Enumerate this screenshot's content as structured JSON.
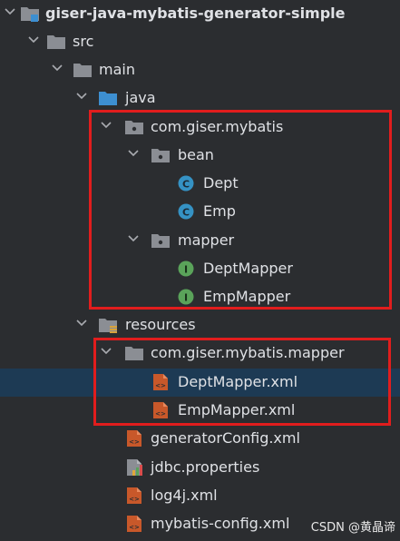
{
  "tree": {
    "root": "giser-java-mybatis-generator-simple",
    "src": "src",
    "main": "main",
    "java": "java",
    "pkg": "com.giser.mybatis",
    "bean": "bean",
    "dept": "Dept",
    "emp": "Emp",
    "mapper": "mapper",
    "dept_mapper": "DeptMapper",
    "emp_mapper": "EmpMapper",
    "resources": "resources",
    "res_pkg": "com.giser.mybatis.mapper",
    "dept_mapper_xml": "DeptMapper.xml",
    "emp_mapper_xml": "EmpMapper.xml",
    "generator_config": "generatorConfig.xml",
    "jdbc_props": "jdbc.properties",
    "log4j": "log4j.xml",
    "mybatis_config": "mybatis-config.xml"
  },
  "watermark": "CSDN @黄晶谛",
  "colors": {
    "background": "#2b2d30",
    "selection": "#1d3a54",
    "highlight_box": "#e11d1d",
    "folder": "#8b8e94",
    "source_folder": "#3d8fd1",
    "class_icon": "#3592c4",
    "interface_icon": "#5aa35a",
    "xml_icon": "#c8582a"
  }
}
